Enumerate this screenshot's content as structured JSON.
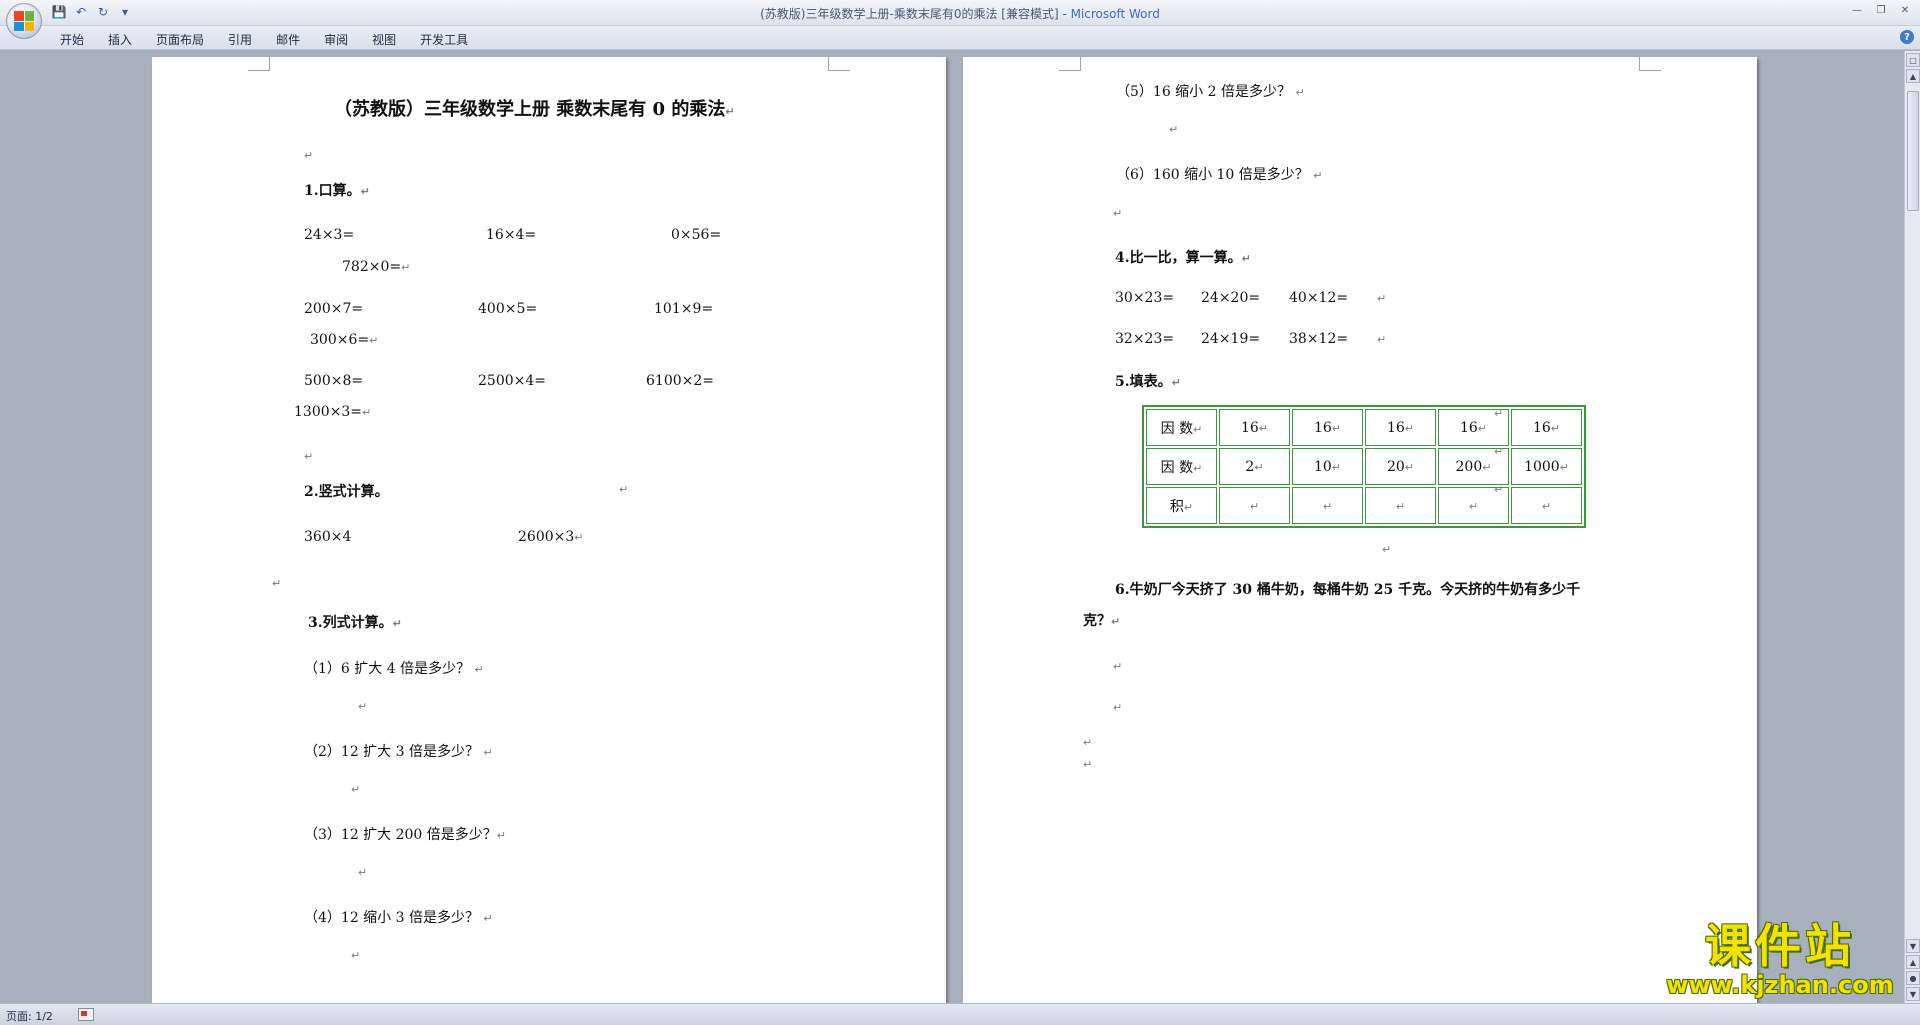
{
  "window": {
    "title_doc": "(苏教版)三年级数学上册-乘数末尾有0的乘法 [兼容模式] - ",
    "title_app": "Microsoft Word"
  },
  "ribbon": {
    "tabs": [
      "开始",
      "插入",
      "页面布局",
      "引用",
      "邮件",
      "审阅",
      "视图",
      "开发工具"
    ]
  },
  "page1": {
    "title": "（苏教版）三年级数学上册  乘数末尾有 0 的乘法",
    "s1_heading": "1.口算。",
    "s1_rows": [
      [
        "24×3=",
        "16×4=",
        "0×56=",
        "782×0="
      ],
      [
        "200×7=",
        "400×5=",
        "101×9=",
        "300×6="
      ],
      [
        "500×8=",
        "2500×4=",
        "6100×2=",
        "1300×3="
      ]
    ],
    "s2_heading": "2.竖式计算。",
    "s2_items": [
      "360×4",
      "2600×3"
    ],
    "s3_heading": "3.列式计算。",
    "s3_items": [
      "（1）6 扩大 4 倍是多少？",
      "（2）12 扩大 3 倍是多少？",
      "（3）12 扩大 200 倍是多少？",
      "（4）12 缩小 3 倍是多少？"
    ]
  },
  "page2": {
    "s3_items": [
      "（5）16 缩小 2 倍是多少？",
      "（6）160 缩小 10 倍是多少？"
    ],
    "s4_heading": "4.比一比，算一算。",
    "s4_rows": [
      [
        "30×23=",
        "24×20=",
        "40×12="
      ],
      [
        "32×23=",
        "24×19=",
        "38×12="
      ]
    ],
    "s5_heading": "5.填表。",
    "table": {
      "rows": [
        [
          "因  数",
          "16",
          "16",
          "16",
          "16",
          "16"
        ],
        [
          "因  数",
          "2",
          "10",
          "20",
          "200",
          "1000"
        ],
        [
          "积",
          "",
          "",
          "",
          "",
          ""
        ]
      ]
    },
    "s6_line1": "6.牛奶厂今天挤了 30 桶牛奶，每桶牛奶 25 千克。今天挤的牛奶有多少千",
    "s6_line2": "克？"
  },
  "status": {
    "page": "页面: 1/2"
  },
  "watermark": {
    "cn": "课件站",
    "url": "www.kjzhan.com"
  },
  "colors": {
    "table_border": "#3a9a3a",
    "watermark": "#f2e200",
    "app_blue": "#3b6cc0"
  }
}
